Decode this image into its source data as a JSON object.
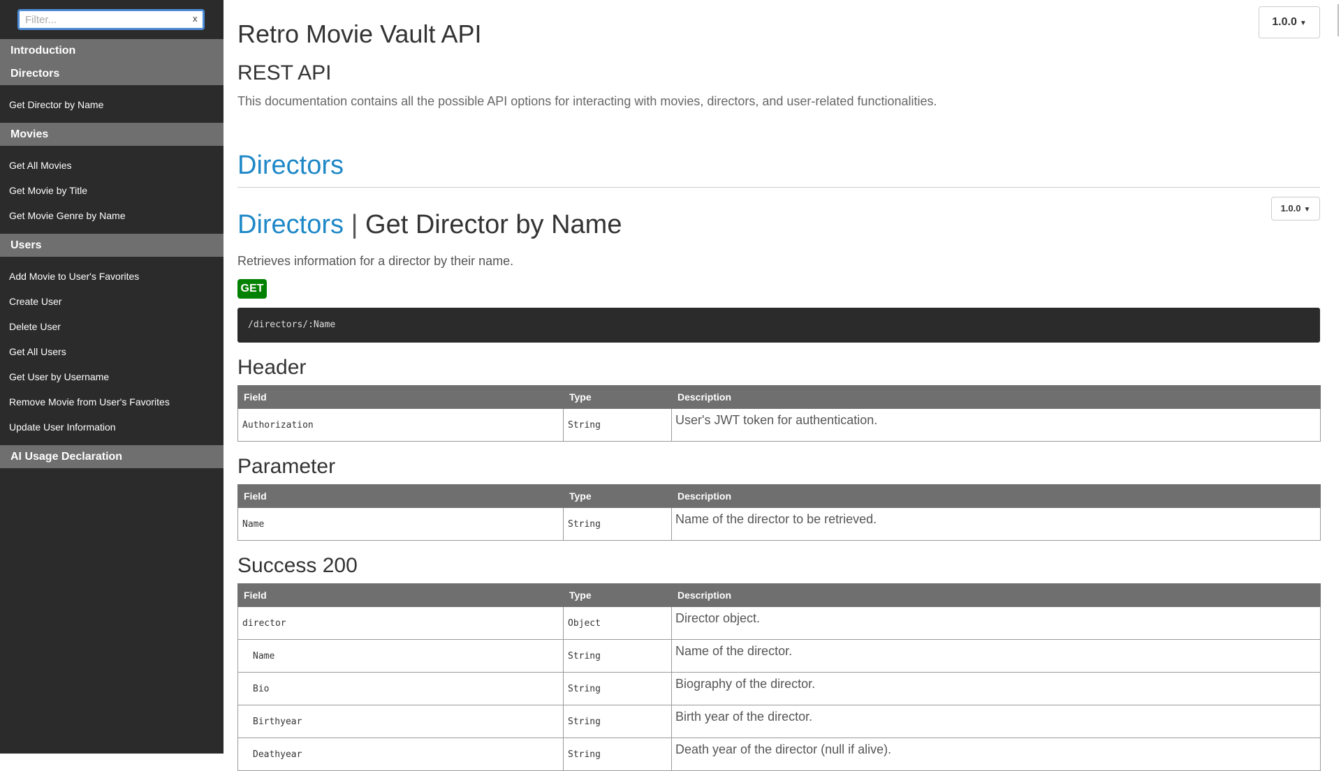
{
  "sidebar": {
    "filter_placeholder": "Filter...",
    "filter_clear": "x",
    "groups": [
      {
        "label": "Introduction",
        "items": []
      },
      {
        "label": "Directors",
        "items": [
          "Get Director by Name"
        ]
      },
      {
        "label": "Movies",
        "items": [
          "Get All Movies",
          "Get Movie by Title",
          "Get Movie Genre by Name"
        ]
      },
      {
        "label": "Users",
        "items": [
          "Add Movie to User's Favorites",
          "Create User",
          "Delete User",
          "Get All Users",
          "Get User by Username",
          "Remove Movie from User's Favorites",
          "Update User Information"
        ]
      },
      {
        "label": "AI Usage Declaration",
        "items": []
      }
    ]
  },
  "header": {
    "title": "Retro Movie Vault API",
    "subtitle": "REST API",
    "description": "This documentation contains all the possible API options for interacting with movies, directors, and user-related functionalities.",
    "version": "1.0.0"
  },
  "section": {
    "title": "Directors"
  },
  "endpoint": {
    "group": "Directors",
    "separator": "|",
    "name": "Get Director by Name",
    "version": "1.0.0",
    "description": "Retrieves information for a director by their name.",
    "method": "GET",
    "url": "/directors/:Name",
    "columns": {
      "field": "Field",
      "type": "Type",
      "description": "Description"
    },
    "header_block": {
      "title": "Header",
      "rows": [
        {
          "field": "Authorization",
          "type": "String",
          "description": "User's JWT token for authentication."
        }
      ]
    },
    "parameter_block": {
      "title": "Parameter",
      "rows": [
        {
          "field": "Name",
          "type": "String",
          "description": "Name of the director to be retrieved."
        }
      ]
    },
    "success_block": {
      "title": "Success 200",
      "rows": [
        {
          "field": "director",
          "type": "Object",
          "description": "Director object."
        },
        {
          "field": "Name",
          "type": "String",
          "description": "Name of the director."
        },
        {
          "field": "Bio",
          "type": "String",
          "description": "Biography of the director."
        },
        {
          "field": "Birthyear",
          "type": "String",
          "description": "Birth year of the director."
        },
        {
          "field": "Deathyear",
          "type": "String",
          "description": "Death year of the director (null if alive)."
        }
      ]
    }
  },
  "colors": {
    "sidebar_bg": "#2b2b2b",
    "nav_header_bg": "#6f6f6f",
    "link_blue": "#1e88c7",
    "get_badge": "#028102",
    "url_block_bg": "#2b2b2b"
  }
}
